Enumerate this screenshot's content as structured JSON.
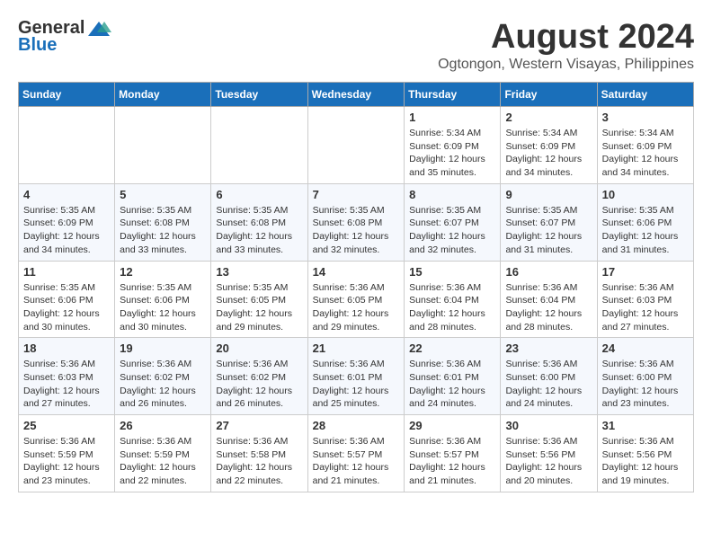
{
  "logo": {
    "general": "General",
    "blue": "Blue"
  },
  "title": {
    "month_year": "August 2024",
    "location": "Ogtongon, Western Visayas, Philippines"
  },
  "headers": [
    "Sunday",
    "Monday",
    "Tuesday",
    "Wednesday",
    "Thursday",
    "Friday",
    "Saturday"
  ],
  "weeks": [
    [
      {
        "day": "",
        "info": ""
      },
      {
        "day": "",
        "info": ""
      },
      {
        "day": "",
        "info": ""
      },
      {
        "day": "",
        "info": ""
      },
      {
        "day": "1",
        "info": "Sunrise: 5:34 AM\nSunset: 6:09 PM\nDaylight: 12 hours\nand 35 minutes."
      },
      {
        "day": "2",
        "info": "Sunrise: 5:34 AM\nSunset: 6:09 PM\nDaylight: 12 hours\nand 34 minutes."
      },
      {
        "day": "3",
        "info": "Sunrise: 5:34 AM\nSunset: 6:09 PM\nDaylight: 12 hours\nand 34 minutes."
      }
    ],
    [
      {
        "day": "4",
        "info": "Sunrise: 5:35 AM\nSunset: 6:09 PM\nDaylight: 12 hours\nand 34 minutes."
      },
      {
        "day": "5",
        "info": "Sunrise: 5:35 AM\nSunset: 6:08 PM\nDaylight: 12 hours\nand 33 minutes."
      },
      {
        "day": "6",
        "info": "Sunrise: 5:35 AM\nSunset: 6:08 PM\nDaylight: 12 hours\nand 33 minutes."
      },
      {
        "day": "7",
        "info": "Sunrise: 5:35 AM\nSunset: 6:08 PM\nDaylight: 12 hours\nand 32 minutes."
      },
      {
        "day": "8",
        "info": "Sunrise: 5:35 AM\nSunset: 6:07 PM\nDaylight: 12 hours\nand 32 minutes."
      },
      {
        "day": "9",
        "info": "Sunrise: 5:35 AM\nSunset: 6:07 PM\nDaylight: 12 hours\nand 31 minutes."
      },
      {
        "day": "10",
        "info": "Sunrise: 5:35 AM\nSunset: 6:06 PM\nDaylight: 12 hours\nand 31 minutes."
      }
    ],
    [
      {
        "day": "11",
        "info": "Sunrise: 5:35 AM\nSunset: 6:06 PM\nDaylight: 12 hours\nand 30 minutes."
      },
      {
        "day": "12",
        "info": "Sunrise: 5:35 AM\nSunset: 6:06 PM\nDaylight: 12 hours\nand 30 minutes."
      },
      {
        "day": "13",
        "info": "Sunrise: 5:35 AM\nSunset: 6:05 PM\nDaylight: 12 hours\nand 29 minutes."
      },
      {
        "day": "14",
        "info": "Sunrise: 5:36 AM\nSunset: 6:05 PM\nDaylight: 12 hours\nand 29 minutes."
      },
      {
        "day": "15",
        "info": "Sunrise: 5:36 AM\nSunset: 6:04 PM\nDaylight: 12 hours\nand 28 minutes."
      },
      {
        "day": "16",
        "info": "Sunrise: 5:36 AM\nSunset: 6:04 PM\nDaylight: 12 hours\nand 28 minutes."
      },
      {
        "day": "17",
        "info": "Sunrise: 5:36 AM\nSunset: 6:03 PM\nDaylight: 12 hours\nand 27 minutes."
      }
    ],
    [
      {
        "day": "18",
        "info": "Sunrise: 5:36 AM\nSunset: 6:03 PM\nDaylight: 12 hours\nand 27 minutes."
      },
      {
        "day": "19",
        "info": "Sunrise: 5:36 AM\nSunset: 6:02 PM\nDaylight: 12 hours\nand 26 minutes."
      },
      {
        "day": "20",
        "info": "Sunrise: 5:36 AM\nSunset: 6:02 PM\nDaylight: 12 hours\nand 26 minutes."
      },
      {
        "day": "21",
        "info": "Sunrise: 5:36 AM\nSunset: 6:01 PM\nDaylight: 12 hours\nand 25 minutes."
      },
      {
        "day": "22",
        "info": "Sunrise: 5:36 AM\nSunset: 6:01 PM\nDaylight: 12 hours\nand 24 minutes."
      },
      {
        "day": "23",
        "info": "Sunrise: 5:36 AM\nSunset: 6:00 PM\nDaylight: 12 hours\nand 24 minutes."
      },
      {
        "day": "24",
        "info": "Sunrise: 5:36 AM\nSunset: 6:00 PM\nDaylight: 12 hours\nand 23 minutes."
      }
    ],
    [
      {
        "day": "25",
        "info": "Sunrise: 5:36 AM\nSunset: 5:59 PM\nDaylight: 12 hours\nand 23 minutes."
      },
      {
        "day": "26",
        "info": "Sunrise: 5:36 AM\nSunset: 5:59 PM\nDaylight: 12 hours\nand 22 minutes."
      },
      {
        "day": "27",
        "info": "Sunrise: 5:36 AM\nSunset: 5:58 PM\nDaylight: 12 hours\nand 22 minutes."
      },
      {
        "day": "28",
        "info": "Sunrise: 5:36 AM\nSunset: 5:57 PM\nDaylight: 12 hours\nand 21 minutes."
      },
      {
        "day": "29",
        "info": "Sunrise: 5:36 AM\nSunset: 5:57 PM\nDaylight: 12 hours\nand 21 minutes."
      },
      {
        "day": "30",
        "info": "Sunrise: 5:36 AM\nSunset: 5:56 PM\nDaylight: 12 hours\nand 20 minutes."
      },
      {
        "day": "31",
        "info": "Sunrise: 5:36 AM\nSunset: 5:56 PM\nDaylight: 12 hours\nand 19 minutes."
      }
    ]
  ]
}
